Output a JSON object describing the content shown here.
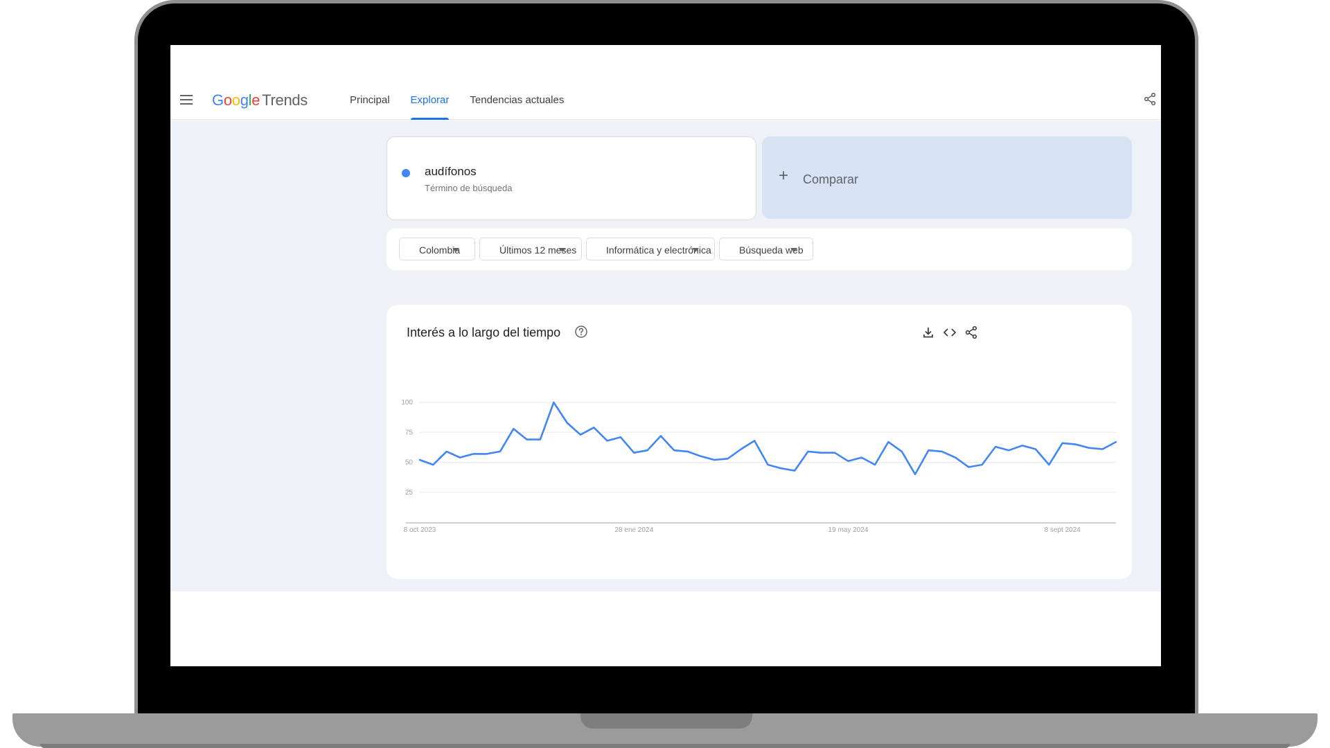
{
  "app": {
    "logo": {
      "google": [
        "G",
        "o",
        "o",
        "g",
        "l",
        "e"
      ],
      "product": "Trends"
    },
    "nav_tabs": [
      {
        "label": "Principal",
        "active": false
      },
      {
        "label": "Explorar",
        "active": true
      },
      {
        "label": "Tendencias actuales",
        "active": false
      }
    ],
    "icons": {
      "menu": "menu-icon",
      "share": "share-icon"
    }
  },
  "search": {
    "term": "audífonos",
    "term_type": "Término de búsqueda",
    "term_color": "#4285f4",
    "compare_label": "Comparar"
  },
  "filters": [
    {
      "label": "Colombia"
    },
    {
      "label": "Últimos 12 meses"
    },
    {
      "label": "Informática y electrónica"
    },
    {
      "label": "Búsqueda web"
    }
  ],
  "chart_section": {
    "title": "Interés a lo largo del tiempo",
    "tools": [
      "download-icon",
      "embed-code-icon",
      "share-icon"
    ]
  },
  "chart_data": {
    "type": "line",
    "title": "Interés a lo largo del tiempo",
    "xlabel": "",
    "ylabel": "",
    "ylim": [
      0,
      100
    ],
    "y_ticks": [
      25,
      50,
      75,
      100
    ],
    "grid": true,
    "x_tick_labels": [
      "8 oct 2023",
      "28 ene 2024",
      "19 may 2024",
      "8 sept 2024"
    ],
    "x_tick_indices": [
      0,
      16,
      32,
      48
    ],
    "series": [
      {
        "color": "#4285f4",
        "values": [
          52,
          48,
          59,
          54,
          57,
          57,
          59,
          78,
          69,
          69,
          100,
          83,
          73,
          79,
          68,
          71,
          58,
          60,
          72,
          60,
          59,
          55,
          52,
          53,
          61,
          68,
          48,
          45,
          43,
          59,
          58,
          58,
          51,
          54,
          48,
          67,
          59,
          40,
          60,
          59,
          54,
          46,
          48,
          63,
          60,
          64,
          61,
          48,
          66,
          65,
          62,
          61,
          67
        ]
      }
    ]
  }
}
